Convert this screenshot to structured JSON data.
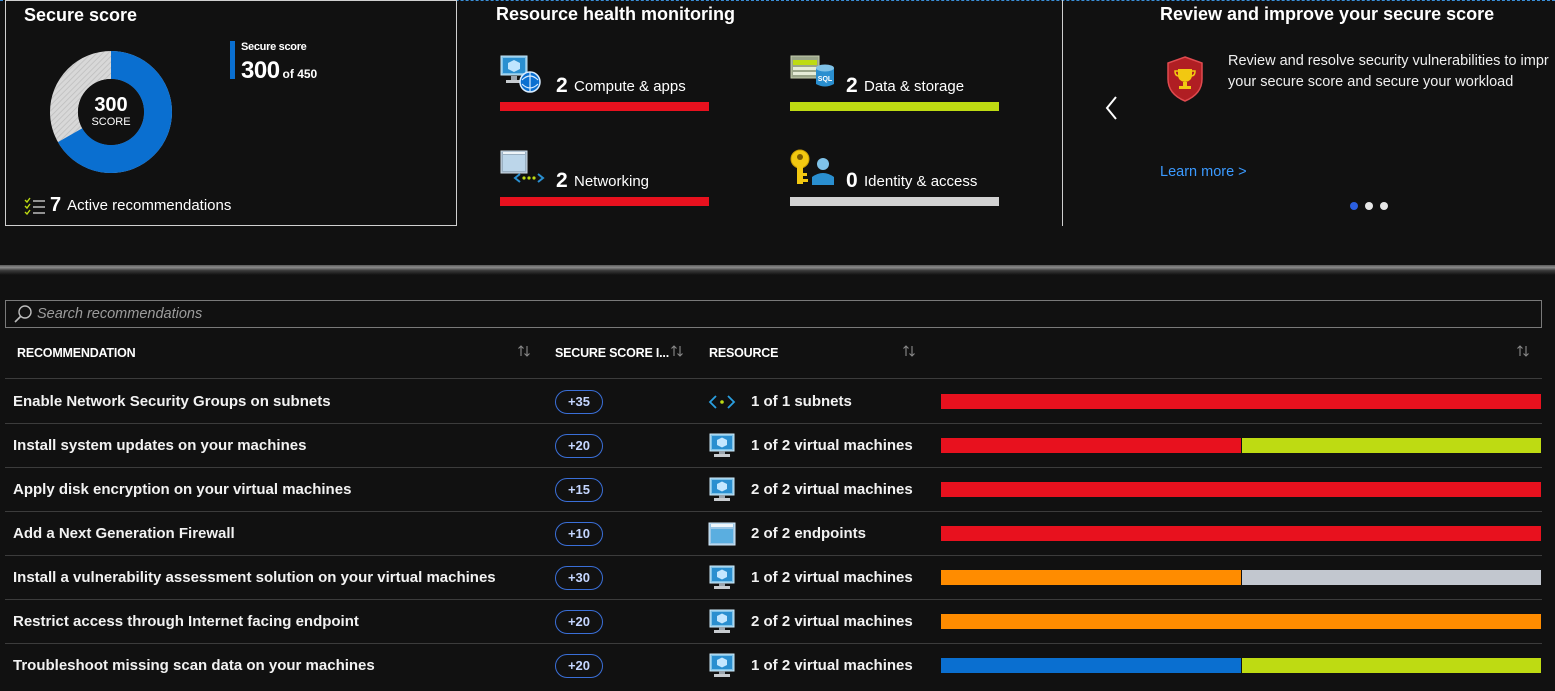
{
  "colors": {
    "red": "#e8111e",
    "lime": "#bedb12",
    "orange": "#ff8c00",
    "grey": "#c2c7cf",
    "blue": "#0a6fd0",
    "light": "#d2d2d2",
    "link": "#3b9aff"
  },
  "secure_score": {
    "title": "Secure score",
    "donut_value": "300",
    "donut_label": "SCORE",
    "legend_label": "Secure score",
    "legend_value": "300",
    "legend_of": "of 450",
    "score": 300,
    "max": 450,
    "active_count": "7",
    "active_label": "Active recommendations"
  },
  "health": {
    "title": "Resource health monitoring",
    "items": [
      {
        "count": "2",
        "label": "Compute & apps",
        "icon": "compute-icon",
        "segments": [
          {
            "color": "red",
            "fraction": 1
          }
        ]
      },
      {
        "count": "2",
        "label": "Data & storage",
        "icon": "sql-storage-icon",
        "segments": [
          {
            "color": "lime",
            "fraction": 1
          }
        ]
      },
      {
        "count": "2",
        "label": "Networking",
        "icon": "networking-icon",
        "segments": [
          {
            "color": "red",
            "fraction": 1
          }
        ]
      },
      {
        "count": "0",
        "label": "Identity & access",
        "icon": "identity-key-icon",
        "segments": [
          {
            "color": "light",
            "fraction": 1
          }
        ]
      }
    ]
  },
  "review": {
    "title": "Review and improve your secure score",
    "text_line1": "Review and resolve security vulnerabilities to impr",
    "text_line2": "your secure score and secure your workload",
    "learn_more": "Learn more >",
    "icon": "trophy-shield-icon",
    "active_dot": 0,
    "dot_count": 3
  },
  "search": {
    "placeholder": "Search recommendations",
    "value": ""
  },
  "table": {
    "headers": [
      "RECOMMENDATION",
      "SECURE SCORE I...",
      "RESOURCE",
      ""
    ],
    "rows": [
      {
        "recommendation": "Enable Network Security Groups on subnets",
        "impact": "+35",
        "resource_icon": "subnet-icon",
        "resource": "1 of 1 subnets",
        "segments": [
          {
            "color": "red",
            "fraction": 1
          }
        ]
      },
      {
        "recommendation": "Install system updates on your machines",
        "impact": "+20",
        "resource_icon": "virtual-machine-icon",
        "resource": "1 of 2 virtual machines",
        "segments": [
          {
            "color": "red",
            "fraction": 0.5
          },
          {
            "color": "lime",
            "fraction": 0.5
          }
        ]
      },
      {
        "recommendation": "Apply disk encryption on your virtual machines",
        "impact": "+15",
        "resource_icon": "virtual-machine-icon",
        "resource": "2 of 2 virtual machines",
        "segments": [
          {
            "color": "red",
            "fraction": 1
          }
        ]
      },
      {
        "recommendation": "Add a Next Generation Firewall",
        "impact": "+10",
        "resource_icon": "endpoint-icon",
        "resource": "2 of 2 endpoints",
        "segments": [
          {
            "color": "red",
            "fraction": 1
          }
        ]
      },
      {
        "recommendation": "Install a vulnerability assessment solution on your virtual machines",
        "impact": "+30",
        "resource_icon": "virtual-machine-icon",
        "resource": "1 of 2 virtual machines",
        "segments": [
          {
            "color": "orange",
            "fraction": 0.5
          },
          {
            "color": "grey",
            "fraction": 0.5
          }
        ]
      },
      {
        "recommendation": "Restrict access through Internet facing endpoint",
        "impact": "+20",
        "resource_icon": "virtual-machine-icon",
        "resource": "2 of 2 virtual machines",
        "segments": [
          {
            "color": "orange",
            "fraction": 1
          }
        ]
      },
      {
        "recommendation": "Troubleshoot missing scan data on your machines",
        "impact": "+20",
        "resource_icon": "virtual-machine-icon",
        "resource": "1 of 2 virtual machines",
        "segments": [
          {
            "color": "blue",
            "fraction": 0.5
          },
          {
            "color": "lime",
            "fraction": 0.5
          }
        ]
      }
    ]
  }
}
